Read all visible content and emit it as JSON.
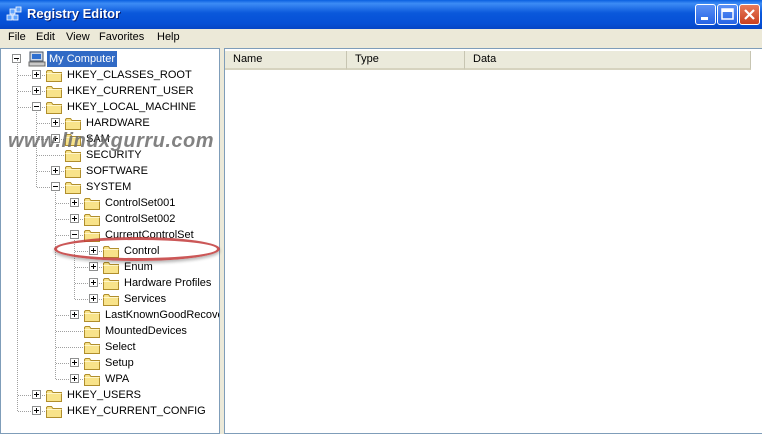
{
  "window": {
    "title": "Registry Editor",
    "app_icon": "registry-editor-icon",
    "title_bar_color": "#0a58db"
  },
  "menu": [
    "File",
    "Edit",
    "View",
    "Favorites",
    "Help"
  ],
  "list_columns": [
    "Name",
    "Type",
    "Data"
  ],
  "tree": {
    "root": "My Computer",
    "nodes": [
      {
        "label": "HKEY_CLASSES_ROOT",
        "expandable": true,
        "expanded": false
      },
      {
        "label": "HKEY_CURRENT_USER",
        "expandable": true,
        "expanded": false
      },
      {
        "label": "HKEY_LOCAL_MACHINE",
        "expandable": true,
        "expanded": true
      },
      {
        "label": "HARDWARE",
        "expandable": true,
        "expanded": false
      },
      {
        "label": "SAM",
        "expandable": true,
        "expanded": false
      },
      {
        "label": "SECURITY",
        "expandable": false,
        "expanded": false
      },
      {
        "label": "SOFTWARE",
        "expandable": true,
        "expanded": false
      },
      {
        "label": "SYSTEM",
        "expandable": true,
        "expanded": true
      },
      {
        "label": "ControlSet001",
        "expandable": true,
        "expanded": false
      },
      {
        "label": "ControlSet002",
        "expandable": true,
        "expanded": false
      },
      {
        "label": "CurrentControlSet",
        "expandable": true,
        "expanded": true
      },
      {
        "label": "Control",
        "expandable": true,
        "expanded": false
      },
      {
        "label": "Enum",
        "expandable": true,
        "expanded": false
      },
      {
        "label": "Hardware Profiles",
        "expandable": true,
        "expanded": false
      },
      {
        "label": "Services",
        "expandable": true,
        "expanded": false
      },
      {
        "label": "LastKnownGoodRecove",
        "expandable": true,
        "expanded": false
      },
      {
        "label": "MountedDevices",
        "expandable": false,
        "expanded": false
      },
      {
        "label": "Select",
        "expandable": false,
        "expanded": false
      },
      {
        "label": "Setup",
        "expandable": true,
        "expanded": false
      },
      {
        "label": "WPA",
        "expandable": true,
        "expanded": false
      },
      {
        "label": "HKEY_USERS",
        "expandable": true,
        "expanded": false
      },
      {
        "label": "HKEY_CURRENT_CONFIG",
        "expandable": true,
        "expanded": false
      }
    ]
  },
  "watermark": "www.linuxgurru.com",
  "highlight_color": "#c23a3a"
}
